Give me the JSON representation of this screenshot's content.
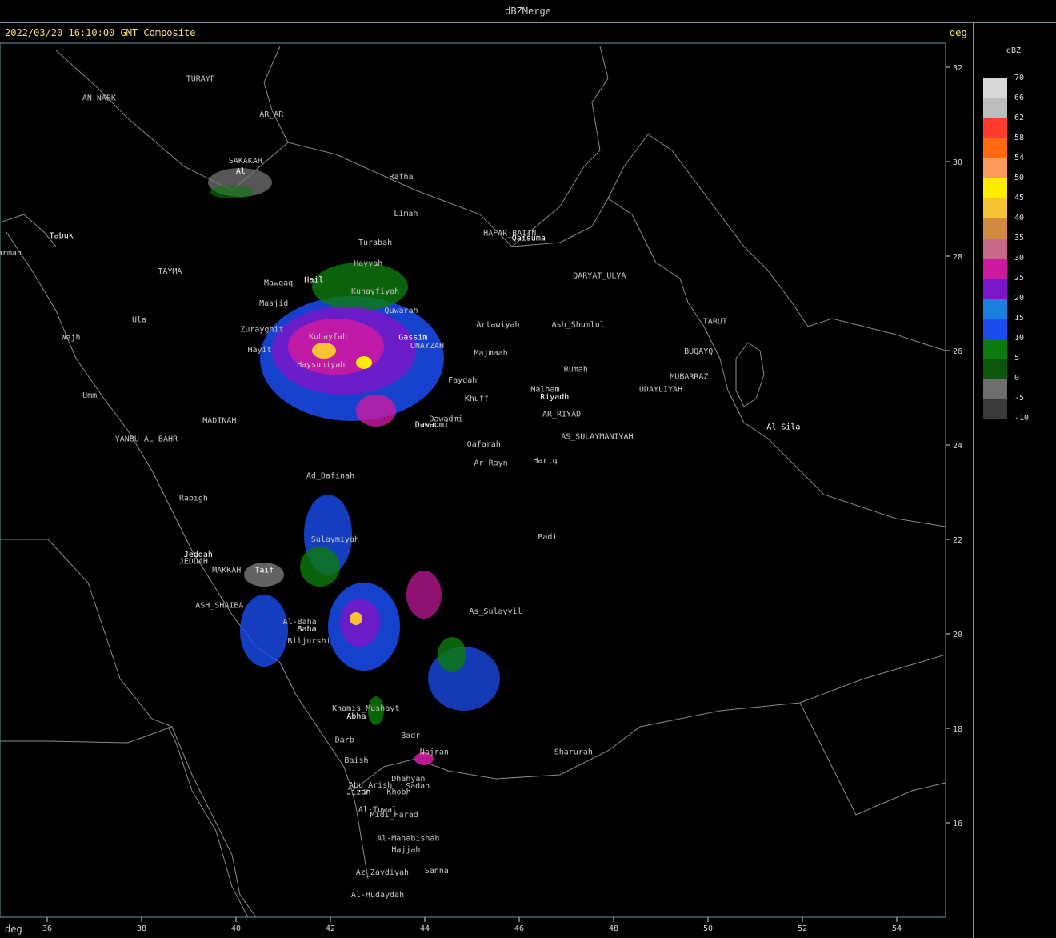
{
  "window": {
    "title": "dBZMerge"
  },
  "header": {
    "timestamp_text": "2022/03/20 16:10:00 GMT Composite",
    "unit_top": "deg",
    "unit_bottom": "deg"
  },
  "axes": {
    "lon_ticks": [
      "36",
      "38",
      "40",
      "42",
      "44",
      "46",
      "48",
      "50",
      "52",
      "54"
    ],
    "lat_ticks": [
      "32",
      "30",
      "28",
      "26",
      "24",
      "22",
      "20",
      "18",
      "16"
    ]
  },
  "legend": {
    "title": "dBZ",
    "entries": [
      {
        "label": "70",
        "color": "#d9d9d9"
      },
      {
        "label": "66",
        "color": "#bdbdbd"
      },
      {
        "label": "62",
        "color": "#ff3b2b"
      },
      {
        "label": "58",
        "color": "#ff6a10"
      },
      {
        "label": "54",
        "color": "#ff9a5a"
      },
      {
        "label": "50",
        "color": "#ffee00"
      },
      {
        "label": "45",
        "color": "#f7c233"
      },
      {
        "label": "40",
        "color": "#d28a40"
      },
      {
        "label": "35",
        "color": "#c76a8a"
      },
      {
        "label": "30",
        "color": "#cc1aa0"
      },
      {
        "label": "25",
        "color": "#7a16c8"
      },
      {
        "label": "20",
        "color": "#1a80e0"
      },
      {
        "label": "15",
        "color": "#1a4cf0"
      },
      {
        "label": "10",
        "color": "#0d7a0d"
      },
      {
        "label": "5",
        "color": "#0b560b"
      },
      {
        "label": "0",
        "color": "#6e6e6e"
      },
      {
        "label": "-5",
        "color": "#3a3a3a"
      },
      {
        "label": "-10",
        "color": ""
      }
    ]
  },
  "cities": [
    {
      "name": "TURAYF",
      "lon": 39.25,
      "lat": 31.7,
      "white": false
    },
    {
      "name": "AN_NABK",
      "lon": 37.1,
      "lat": 31.3,
      "white": false
    },
    {
      "name": "AR_AR",
      "lon": 40.75,
      "lat": 30.95,
      "white": false
    },
    {
      "name": "SAKAKAH",
      "lon": 40.2,
      "lat": 29.97,
      "white": false
    },
    {
      "name": "Al",
      "lon": 40.1,
      "lat": 29.75,
      "white": true
    },
    {
      "name": "Rafha",
      "lon": 43.5,
      "lat": 29.63,
      "white": false
    },
    {
      "name": "Limah",
      "lon": 43.6,
      "lat": 28.85,
      "white": false
    },
    {
      "name": "HAFAR_BATIN",
      "lon": 45.8,
      "lat": 28.43,
      "white": false
    },
    {
      "name": "Qaisuma",
      "lon": 46.2,
      "lat": 28.33,
      "white": true
    },
    {
      "name": "Tabuk",
      "lon": 36.3,
      "lat": 28.38,
      "white": true
    },
    {
      "name": "Turabah",
      "lon": 42.95,
      "lat": 28.24,
      "white": false
    },
    {
      "name": "Sharmah",
      "lon": 35.1,
      "lat": 28.02,
      "white": false
    },
    {
      "name": "Hayyah",
      "lon": 42.8,
      "lat": 27.8,
      "white": false
    },
    {
      "name": "TAYMA",
      "lon": 38.6,
      "lat": 27.63,
      "white": false
    },
    {
      "name": "QARYAT_ULYA",
      "lon": 47.7,
      "lat": 27.53,
      "white": false
    },
    {
      "name": "Hail",
      "lon": 41.65,
      "lat": 27.45,
      "white": true
    },
    {
      "name": "Mawqaq",
      "lon": 40.9,
      "lat": 27.38,
      "white": false
    },
    {
      "name": "Kuhayfiyah",
      "lon": 42.95,
      "lat": 27.2,
      "white": false
    },
    {
      "name": "Masjid",
      "lon": 40.8,
      "lat": 26.95,
      "white": false
    },
    {
      "name": "Quwarah",
      "lon": 43.5,
      "lat": 26.8,
      "white": false
    },
    {
      "name": "Ula",
      "lon": 37.95,
      "lat": 26.6,
      "white": false
    },
    {
      "name": "Artawiyah",
      "lon": 45.55,
      "lat": 26.5,
      "white": false
    },
    {
      "name": "Ash_Shumlul",
      "lon": 47.25,
      "lat": 26.5,
      "white": false
    },
    {
      "name": "TARUT",
      "lon": 50.15,
      "lat": 26.57,
      "white": false
    },
    {
      "name": "Zurayghit",
      "lon": 40.55,
      "lat": 26.4,
      "white": false
    },
    {
      "name": "Kuhayfah",
      "lon": 41.95,
      "lat": 26.25,
      "white": false
    },
    {
      "name": "Gassim",
      "lon": 43.75,
      "lat": 26.23,
      "white": true
    },
    {
      "name": "UNAYZAH",
      "lon": 44.05,
      "lat": 26.05,
      "white": false
    },
    {
      "name": "Wajh",
      "lon": 36.5,
      "lat": 26.23,
      "white": false
    },
    {
      "name": "Hayit",
      "lon": 40.5,
      "lat": 25.97,
      "white": false
    },
    {
      "name": "Majmaah",
      "lon": 45.4,
      "lat": 25.9,
      "white": false
    },
    {
      "name": "BUQAYQ",
      "lon": 49.8,
      "lat": 25.93,
      "white": false
    },
    {
      "name": "Haysuniyah",
      "lon": 41.8,
      "lat": 25.65,
      "white": false
    },
    {
      "name": "Rumah",
      "lon": 47.2,
      "lat": 25.55,
      "white": false
    },
    {
      "name": "MUBARRAZ",
      "lon": 49.6,
      "lat": 25.4,
      "white": false
    },
    {
      "name": "Faydah",
      "lon": 44.8,
      "lat": 25.32,
      "white": false
    },
    {
      "name": "UDAYLIYAH",
      "lon": 49.0,
      "lat": 25.13,
      "white": false
    },
    {
      "name": "Malham",
      "lon": 46.55,
      "lat": 25.13,
      "white": false
    },
    {
      "name": "Riyadh",
      "lon": 46.75,
      "lat": 24.97,
      "white": true
    },
    {
      "name": "Khuff",
      "lon": 45.1,
      "lat": 24.93,
      "white": false
    },
    {
      "name": "Umm",
      "lon": 36.9,
      "lat": 25.0,
      "white": false
    },
    {
      "name": "AR_RIYAD",
      "lon": 46.9,
      "lat": 24.6,
      "white": false
    },
    {
      "name": "MADINAH",
      "lon": 39.65,
      "lat": 24.47,
      "white": false
    },
    {
      "name": "Dawadmi",
      "lon": 44.45,
      "lat": 24.5,
      "white": false
    },
    {
      "name": "Dawadmi",
      "lon": 44.15,
      "lat": 24.38,
      "white": true
    },
    {
      "name": "Al-Sila",
      "lon": 51.6,
      "lat": 24.33,
      "white": true
    },
    {
      "name": "AS_SULAYMANIYAH",
      "lon": 47.65,
      "lat": 24.13,
      "white": false
    },
    {
      "name": "YANBU_AL_BAHR",
      "lon": 38.1,
      "lat": 24.08,
      "white": false
    },
    {
      "name": "Qafarah",
      "lon": 45.25,
      "lat": 23.97,
      "white": false
    },
    {
      "name": "Hariq",
      "lon": 46.55,
      "lat": 23.62,
      "white": false
    },
    {
      "name": "Ar_Rayn",
      "lon": 45.4,
      "lat": 23.57,
      "white": false
    },
    {
      "name": "Ad_Dafinah",
      "lon": 42.0,
      "lat": 23.3,
      "white": false
    },
    {
      "name": "Rabigh",
      "lon": 39.1,
      "lat": 22.82,
      "white": false
    },
    {
      "name": "Badi",
      "lon": 46.6,
      "lat": 22.0,
      "white": false
    },
    {
      "name": "Sulaymiyah",
      "lon": 42.1,
      "lat": 21.95,
      "white": false
    },
    {
      "name": "Jeddah",
      "lon": 39.2,
      "lat": 21.63,
      "white": true
    },
    {
      "name": "JEDDAH",
      "lon": 39.1,
      "lat": 21.48,
      "white": false
    },
    {
      "name": "MAKKAH",
      "lon": 39.8,
      "lat": 21.3,
      "white": false
    },
    {
      "name": "Taif",
      "lon": 40.6,
      "lat": 21.3,
      "white": true
    },
    {
      "name": "ASH_SHAIBA",
      "lon": 39.65,
      "lat": 20.55,
      "white": false
    },
    {
      "name": "As_Sulayyil",
      "lon": 45.5,
      "lat": 20.42,
      "white": false
    },
    {
      "name": "Al-Baha",
      "lon": 41.35,
      "lat": 20.2,
      "white": false
    },
    {
      "name": "Baha",
      "lon": 41.5,
      "lat": 20.05,
      "white": true
    },
    {
      "name": "Biljurshi",
      "lon": 41.55,
      "lat": 19.8,
      "white": false
    },
    {
      "name": "Khamis_Mushayt",
      "lon": 42.75,
      "lat": 18.37,
      "white": false
    },
    {
      "name": "Abha",
      "lon": 42.55,
      "lat": 18.2,
      "white": true
    },
    {
      "name": "Badr",
      "lon": 43.7,
      "lat": 17.8,
      "white": false
    },
    {
      "name": "Darb",
      "lon": 42.3,
      "lat": 17.7,
      "white": false
    },
    {
      "name": "Najran",
      "lon": 44.2,
      "lat": 17.45,
      "white": false
    },
    {
      "name": "Sharurah",
      "lon": 47.15,
      "lat": 17.45,
      "white": false
    },
    {
      "name": "Baish",
      "lon": 42.55,
      "lat": 17.27,
      "white": false
    },
    {
      "name": "Dhahyan",
      "lon": 43.65,
      "lat": 16.88,
      "white": false
    },
    {
      "name": "Sadah",
      "lon": 43.85,
      "lat": 16.73,
      "white": false
    },
    {
      "name": "Abu_Arish",
      "lon": 42.85,
      "lat": 16.75,
      "white": false
    },
    {
      "name": "Jizan",
      "lon": 42.6,
      "lat": 16.6,
      "white": true
    },
    {
      "name": "Khobh",
      "lon": 43.45,
      "lat": 16.6,
      "white": false
    },
    {
      "name": "Al-Tuwal",
      "lon": 43.0,
      "lat": 16.23,
      "white": false
    },
    {
      "name": "Midi_Harad",
      "lon": 43.35,
      "lat": 16.12,
      "white": false
    },
    {
      "name": "Al-Mahabishah",
      "lon": 43.65,
      "lat": 15.62,
      "white": false
    },
    {
      "name": "Hajjah",
      "lon": 43.6,
      "lat": 15.38,
      "white": false
    },
    {
      "name": "Sanna",
      "lon": 44.25,
      "lat": 14.93,
      "white": false
    },
    {
      "name": "Az_Zaydiyah",
      "lon": 43.1,
      "lat": 14.9,
      "white": false
    },
    {
      "name": "Al-Hudaydah",
      "lon": 43.0,
      "lat": 14.42,
      "white": false
    }
  ]
}
